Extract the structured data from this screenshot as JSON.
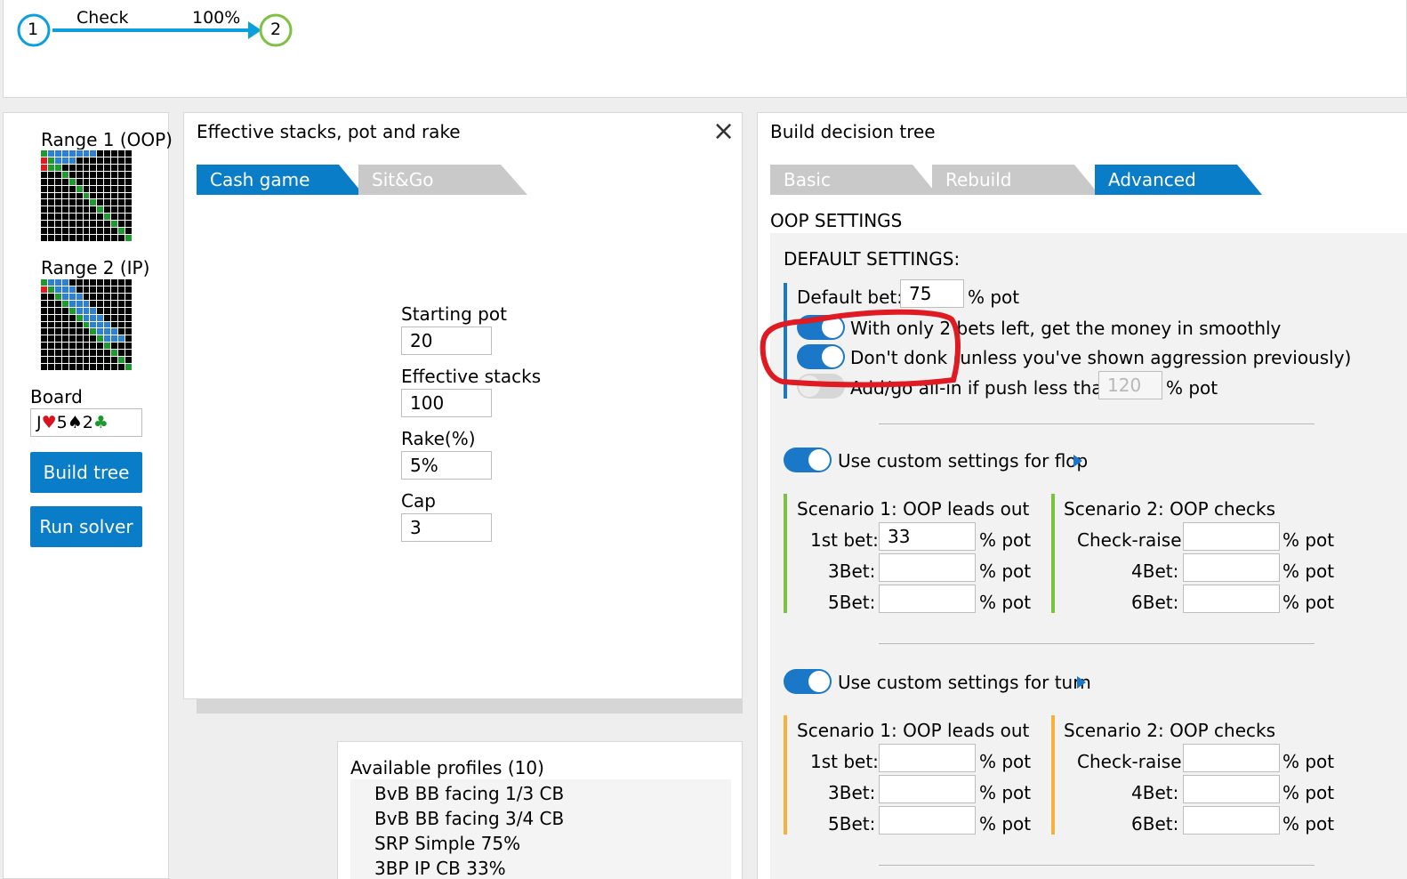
{
  "tree_path": {
    "node1": "1",
    "node2": "2",
    "action": "Check",
    "percent": "100%"
  },
  "sidebar": {
    "range1_label": "Range 1 (OOP)",
    "range2_label": "Range 2 (IP)",
    "board_label": "Board",
    "board_value": {
      "c1_rank": "J",
      "c1_suit": "♥",
      "c2_rank": "5",
      "c2_suit": "♠",
      "c3_rank": "2",
      "c3_suit": "♣"
    },
    "build_tree": "Build tree",
    "run_solver": "Run solver"
  },
  "stacks_panel": {
    "title": "Effective stacks, pot and rake",
    "close": "×",
    "tabs": [
      "Cash game",
      "Sit&Go"
    ],
    "fields": [
      {
        "label": "Starting pot",
        "value": "20"
      },
      {
        "label": "Effective stacks",
        "value": "100"
      },
      {
        "label": "Rake(%)",
        "value": "5%"
      },
      {
        "label": "Cap",
        "value": "3"
      }
    ]
  },
  "profiles": {
    "title": "Available profiles (10)",
    "items": [
      "BvB BB facing 1/3 CB",
      "BvB BB facing 3/4 CB",
      "SRP Simple 75%",
      "3BP IP CB 33%"
    ]
  },
  "tree_panel": {
    "title": "Build decision tree",
    "tabs": [
      "Basic",
      "Rebuild",
      "Advanced"
    ],
    "section": "OOP SETTINGS",
    "default_header": "DEFAULT SETTINGS:",
    "default_bet_label": "Default bet:",
    "default_bet_value": "75",
    "pct_pot": "% pot",
    "toggle1": "With only 2 bets left, get the money in smoothly",
    "toggle2": "Don't donk (unless you've shown aggression previously)",
    "toggle3": "Add/go all-in if push less than",
    "toggle3_value": "120",
    "flop_toggle": "Use custom settings for flop",
    "turn_toggle": "Use custom settings for turn",
    "scenario1": "Scenario 1: OOP leads out",
    "scenario2": "Scenario 2: OOP checks",
    "s1_labels": [
      "1st bet:",
      "3Bet:",
      "5Bet:"
    ],
    "s2_labels": [
      "Check-raise:",
      "4Bet:",
      "6Bet:"
    ],
    "flop_s1_values": [
      "33",
      "",
      ""
    ],
    "flop_s2_values": [
      "",
      "",
      ""
    ],
    "turn_s1_values": [
      "",
      "",
      ""
    ],
    "turn_s2_values": [
      "",
      "",
      ""
    ]
  },
  "colors": {
    "accent": "#0a7dc8",
    "annotation": "#e01a22",
    "flop_bar": "#7cc142",
    "turn_bar": "#f2b23c",
    "default_bar": "#1b78c8"
  }
}
